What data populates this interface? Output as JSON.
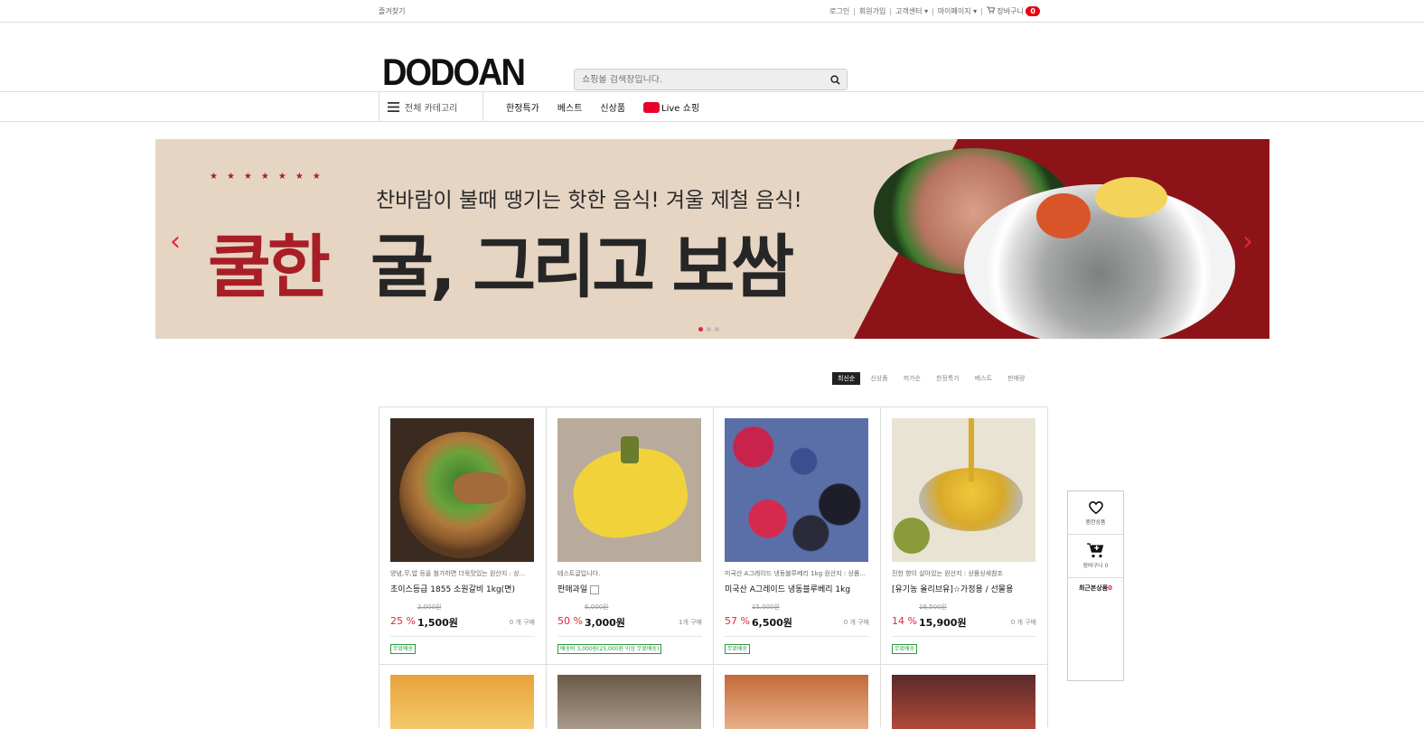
{
  "topbar": {
    "bookmark": "즐겨찾기",
    "login": "로그인",
    "signup": "회원가입",
    "support": "고객센터",
    "mypage": "마이페이지",
    "cart": "장바구니",
    "cart_count": "0",
    "sep": "|"
  },
  "header": {
    "logo": "DODOAN",
    "search_placeholder": "쇼핑몰 검색창입니다."
  },
  "nav": {
    "all_category": "전체 카테고리",
    "items": [
      "한정특가",
      "베스트",
      "신상품",
      "Live 쇼핑"
    ]
  },
  "banner": {
    "subtitle": "찬바람이 불때 땡기는 핫한 음식! 겨울 제철 음식!",
    "title_red": "쿨한",
    "title_dark": "굴, 그리고 보쌈",
    "stars": "★★★★★★★",
    "prev": "‹",
    "next": "›"
  },
  "sort": {
    "tabs": [
      "최신순",
      "신상품",
      "저가순",
      "한정특가",
      "베스트",
      "판매량"
    ],
    "active": 0
  },
  "products": [
    {
      "desc": "양념,무,밥 등을 첨가하면 더욱맛있는 원산지 : 상...",
      "name": "초이스등급 1855 소원갈비 1kg(면)",
      "orig": "2,000원",
      "rate": "25 %",
      "price": "1,500원",
      "bought": "0 개 구매",
      "ship": "무료배송"
    },
    {
      "desc": "테스트글입니다.",
      "name": "판매과일",
      "orig": "6,000원",
      "rate": "50 %",
      "price": "3,000원",
      "bought": "1개 구매",
      "ship": "배송비 3,000원(25,000원 이상 무료배송)"
    },
    {
      "desc": "미국산 A그레이드 냉동블루베리 1kg 원산지 : 상품...",
      "name": "미국산 A그레이드 냉동블루베리 1kg",
      "orig": "15,000원",
      "rate": "57 %",
      "price": "6,500원",
      "bought": "0 개 구매",
      "ship": "무료배송"
    },
    {
      "desc": "진한 향이 살아있는 원산지 : 상품상세참조",
      "name": "[유기농 올리브유]☆가정용 / 선물용",
      "orig": "18,500원",
      "rate": "14 %",
      "price": "15,900원",
      "bought": "0 개 구매",
      "ship": "무료배송"
    }
  ],
  "quick": {
    "wish": "찜한상품",
    "cart": "장바구니",
    "cart_count": "0",
    "recent": "최근본상품",
    "recent_count": "0"
  },
  "colors": {
    "accent": "#e3263a",
    "banner_red": "#8c1418",
    "banner_bg": "#e6d5c3",
    "ship_green": "#2a9a3f"
  }
}
